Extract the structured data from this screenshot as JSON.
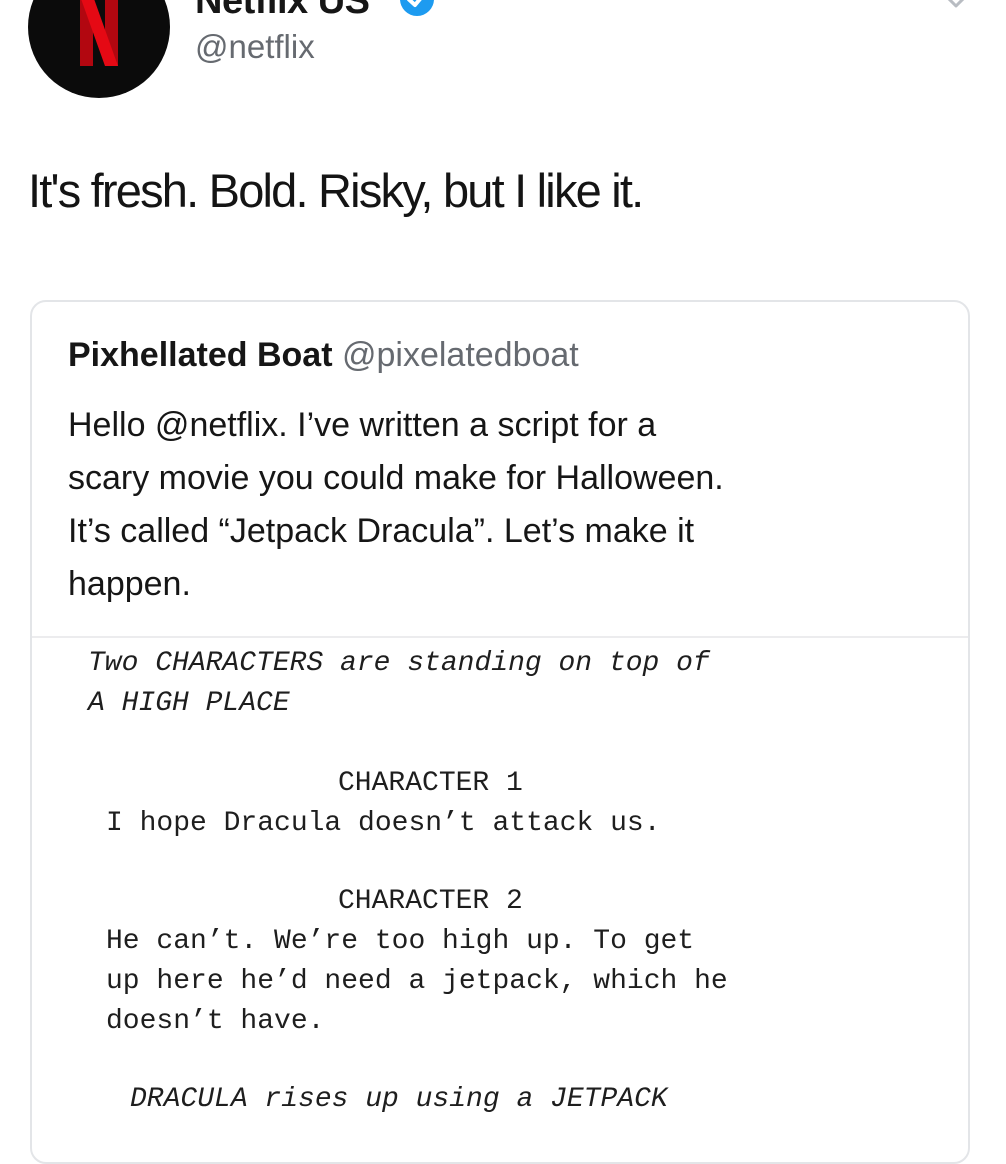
{
  "tweet": {
    "author": {
      "display_name": "Netflix US",
      "handle": "@netflix",
      "verified": true,
      "avatar_icon": "netflix-logo-icon"
    },
    "text": "It's fresh. Bold. Risky, but I like it.",
    "colors": {
      "brand_red": "#e50914",
      "verified_blue": "#1d9bf0"
    }
  },
  "quoted_tweet": {
    "author": {
      "display_name": "Pixhellated Boat",
      "handle": "@pixelatedboat"
    },
    "text_lines": [
      "Hello @netflix. I’ve written a script for a",
      "scary movie you could make for Halloween.",
      "It’s called “Jetpack Dracula”. Let’s make it",
      "happen."
    ],
    "script": {
      "action_1_line_1": "Two CHARACTERS are standing on top of",
      "action_1_line_2": "A HIGH PLACE",
      "character_1": "CHARACTER 1",
      "dialogue_1": "I hope Dracula doesn’t attack us.",
      "character_2": "CHARACTER 2",
      "dialogue_2_line_1": "He can’t. We’re too high up. To get",
      "dialogue_2_line_2": "up here he’d need a jetpack, which he",
      "dialogue_2_line_3": "doesn’t have.",
      "action_2": "DRACULA rises up using a JETPACK"
    }
  }
}
